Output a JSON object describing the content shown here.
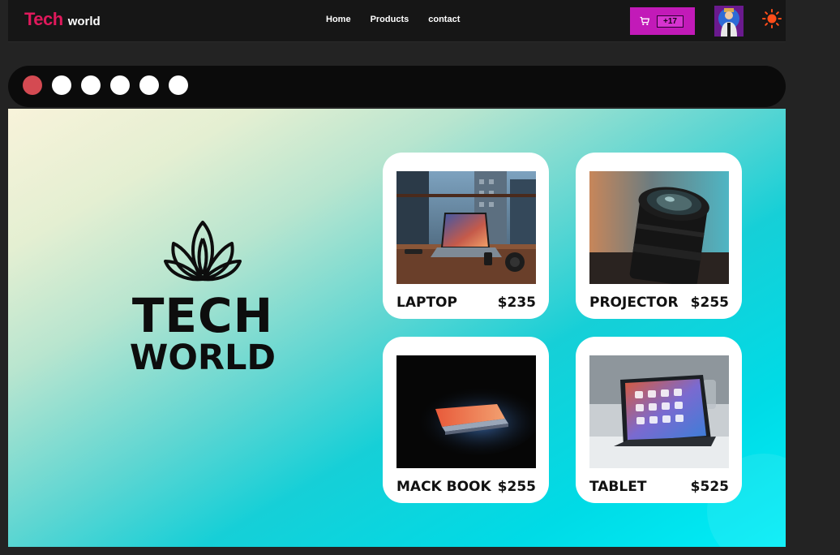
{
  "header": {
    "logo_primary": "Tech",
    "logo_secondary": "world",
    "nav": [
      {
        "label": "Home"
      },
      {
        "label": "Products"
      },
      {
        "label": "contact"
      }
    ],
    "cart": {
      "icon": "cart-icon",
      "count": "+17",
      "color": "#c21ab8"
    },
    "avatar_icon": "avatar",
    "theme_icon": "sun-icon"
  },
  "slider": {
    "dot_count": 6,
    "active_index": 0,
    "active_color": "#d44a52"
  },
  "hero": {
    "brand_line1": "TECH",
    "brand_line2": "WORLD",
    "logo_icon": "lotus-icon"
  },
  "products": [
    {
      "name": "LAPTOP",
      "price": "$235"
    },
    {
      "name": "PROJECTOR",
      "price": "$255"
    },
    {
      "name": "MACK BOOK",
      "price": "$255"
    },
    {
      "name": "TABLET",
      "price": "$525"
    }
  ],
  "colors": {
    "accent": "#e0195c",
    "navbar": "#161616",
    "background": "#232323"
  }
}
